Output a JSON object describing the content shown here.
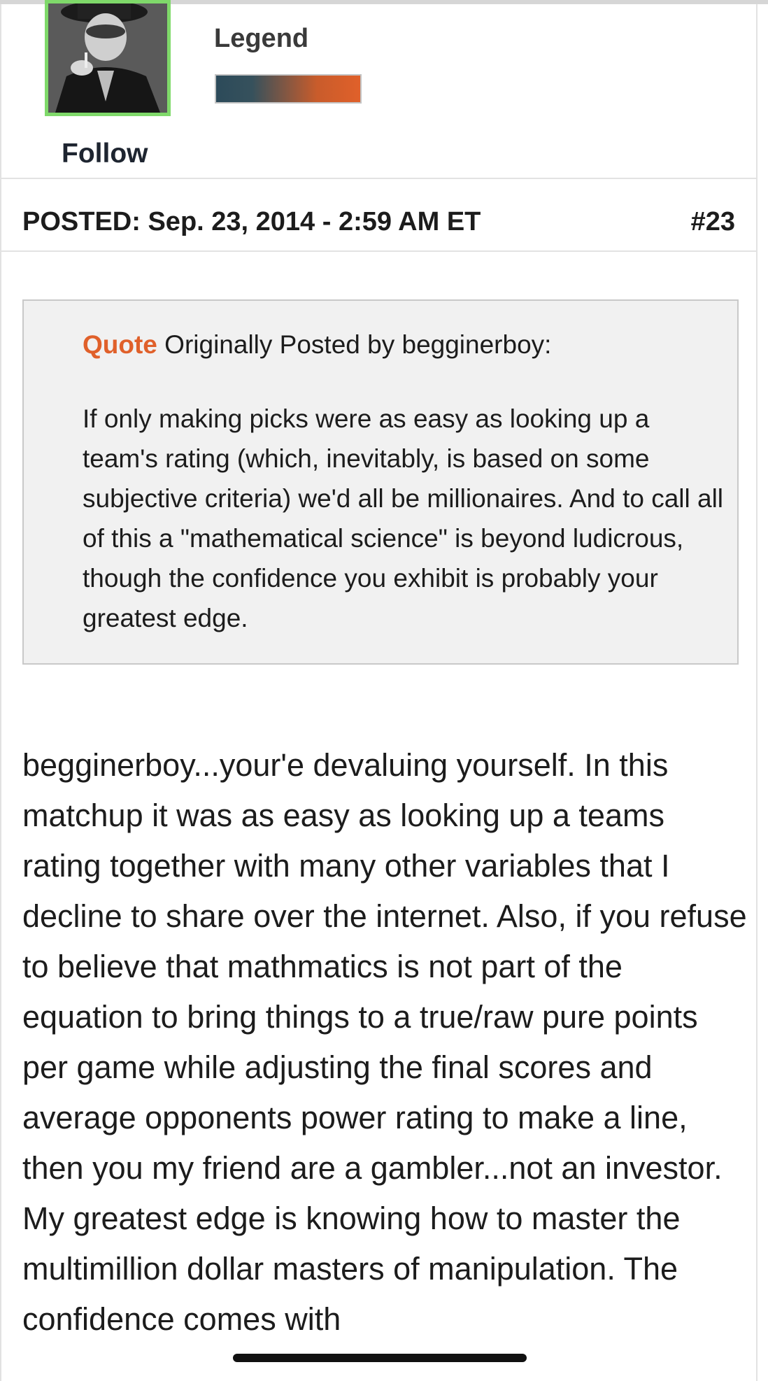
{
  "profile": {
    "rank_title": "Legend",
    "follow_label": "Follow",
    "rank_bar_colors": [
      "#2c4a5a",
      "#e0602a"
    ],
    "avatar_border_color": "#7fd96a"
  },
  "post": {
    "posted_label": "POSTED: Sep. 23, 2014 - 2:59 AM ET",
    "number": "#23",
    "quote": {
      "label": "Quote",
      "attribution": " Originally Posted by begginerboy:",
      "text": "If only making picks were as easy as looking up a team's rating (which, inevitably, is based on some subjective criteria) we'd all be millionaires. And to call all of this a \"mathematical science\" is beyond ludicrous, though the confidence you exhibit is probably your greatest edge."
    },
    "body": "begginerboy...your'e devaluing yourself. In this matchup it was as easy as looking up a teams rating together with many other variables that I decline to share over the internet. Also, if you refuse to believe that mathmatics is not part of the equation to bring things to a true/raw pure points per game while adjusting the final scores and average opponents power rating to make a line, then you my friend are a gambler...not an investor. My greatest edge is knowing how to master the multimillion dollar masters of manipulation. The confidence comes with"
  },
  "colors": {
    "accent": "#e0602a",
    "text": "#1c1c1c",
    "quote_background": "#f1f1f1"
  }
}
